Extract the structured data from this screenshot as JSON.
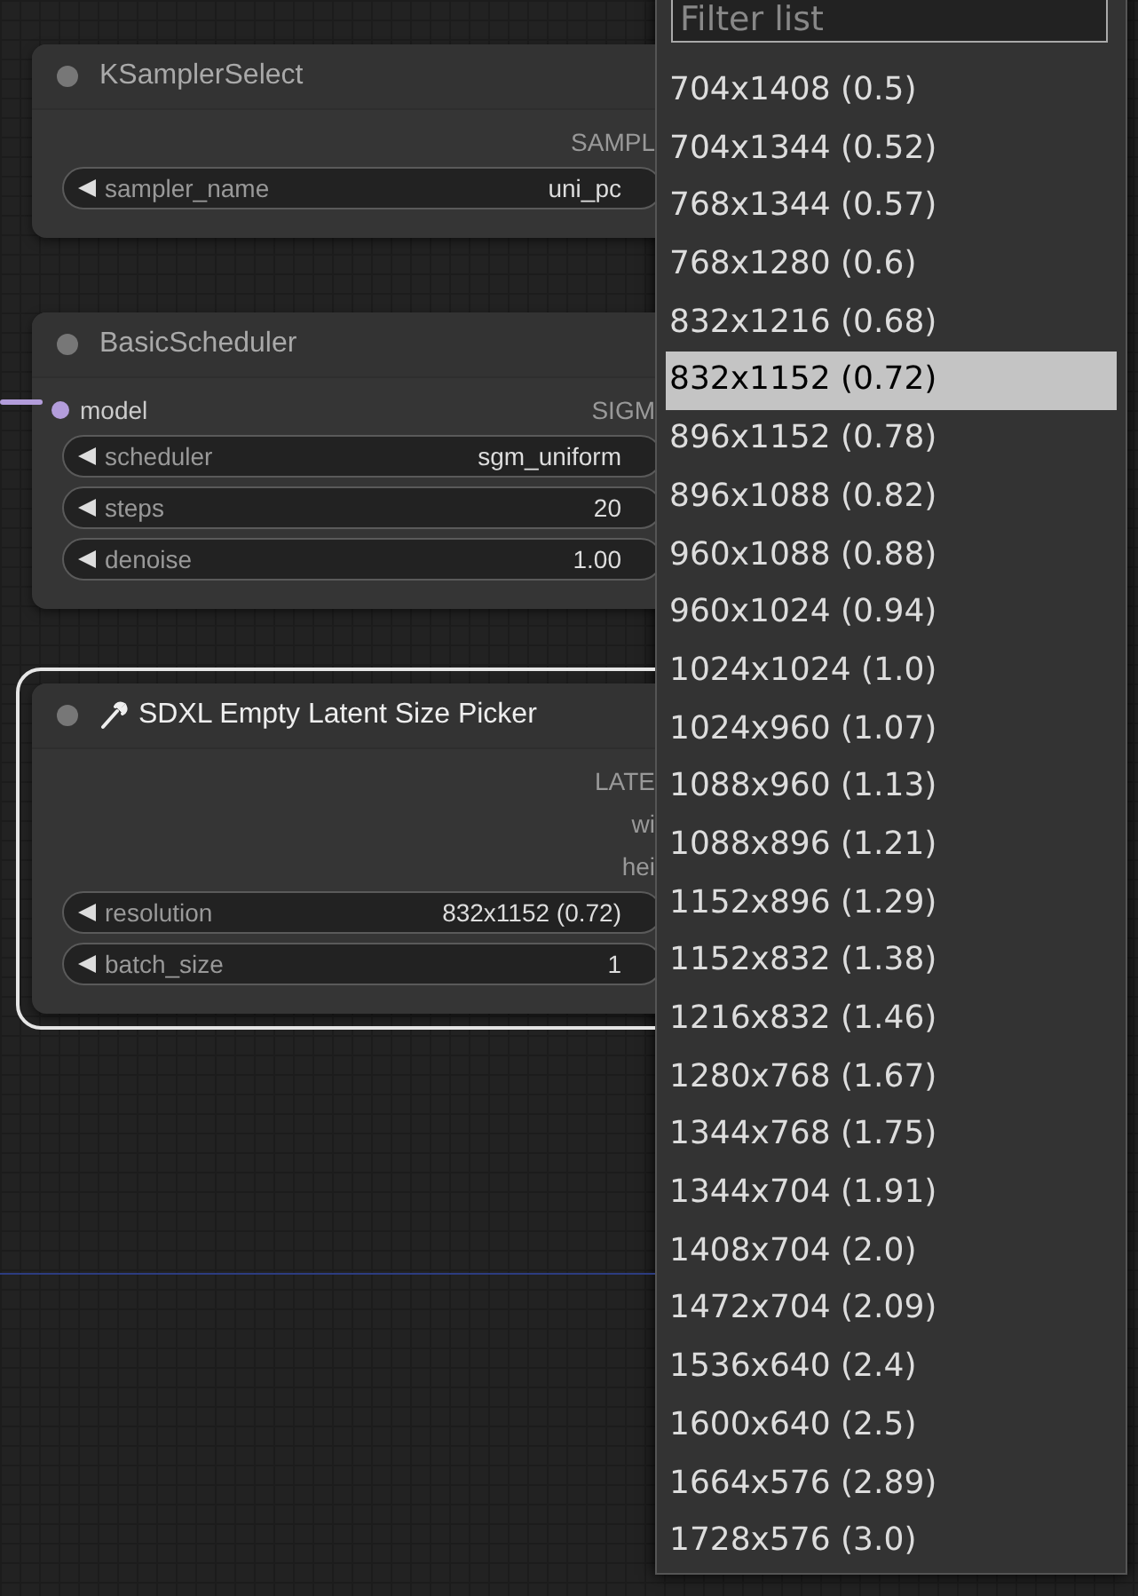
{
  "nodes": [
    {
      "title": "KSamplerSelect",
      "kind": "core",
      "selected": false,
      "slots": [
        {
          "output": "SAMPL"
        }
      ],
      "widgets": [
        {
          "name": "sampler_name",
          "value": "uni_pc"
        }
      ]
    },
    {
      "title": "BasicScheduler",
      "kind": "core",
      "selected": false,
      "slots": [
        {
          "input": "model",
          "connected": true,
          "output": "SIGM"
        }
      ],
      "widgets": [
        {
          "name": "scheduler",
          "value": "sgm_uniform"
        },
        {
          "name": "steps",
          "value": "20"
        },
        {
          "name": "denoise",
          "value": "1.00"
        }
      ]
    },
    {
      "title": "SDXL Empty Latent Size Picker",
      "kind": "custom",
      "selected": true,
      "slots": [
        {
          "output": "LATE"
        },
        {
          "output": "wi"
        },
        {
          "output": "hei"
        }
      ],
      "widgets": [
        {
          "name": "resolution",
          "value": "832x1152 (0.72)"
        },
        {
          "name": "batch_size",
          "value": "1"
        }
      ]
    }
  ],
  "menu": {
    "placeholder": "Filter list",
    "items": [
      {
        "label": "704x1408 (0.5)",
        "selected": false
      },
      {
        "label": "704x1344 (0.52)",
        "selected": false
      },
      {
        "label": "768x1344 (0.57)",
        "selected": false
      },
      {
        "label": "768x1280 (0.6)",
        "selected": false
      },
      {
        "label": "832x1216 (0.68)",
        "selected": false
      },
      {
        "label": "832x1152 (0.72)",
        "selected": true
      },
      {
        "label": "896x1152 (0.78)",
        "selected": false
      },
      {
        "label": "896x1088 (0.82)",
        "selected": false
      },
      {
        "label": "960x1088 (0.88)",
        "selected": false
      },
      {
        "label": "960x1024 (0.94)",
        "selected": false
      },
      {
        "label": "1024x1024 (1.0)",
        "selected": false
      },
      {
        "label": "1024x960 (1.07)",
        "selected": false
      },
      {
        "label": "1088x960 (1.13)",
        "selected": false
      },
      {
        "label": "1088x896 (1.21)",
        "selected": false
      },
      {
        "label": "1152x896 (1.29)",
        "selected": false
      },
      {
        "label": "1152x832 (1.38)",
        "selected": false
      },
      {
        "label": "1216x832 (1.46)",
        "selected": false
      },
      {
        "label": "1280x768 (1.67)",
        "selected": false
      },
      {
        "label": "1344x768 (1.75)",
        "selected": false
      },
      {
        "label": "1344x704 (1.91)",
        "selected": false
      },
      {
        "label": "1408x704 (2.0)",
        "selected": false
      },
      {
        "label": "1472x704 (2.09)",
        "selected": false
      },
      {
        "label": "1536x640 (2.4)",
        "selected": false
      },
      {
        "label": "1600x640 (2.5)",
        "selected": false
      },
      {
        "label": "1664x576 (2.89)",
        "selected": false
      },
      {
        "label": "1728x576 (3.0)",
        "selected": false
      }
    ]
  }
}
